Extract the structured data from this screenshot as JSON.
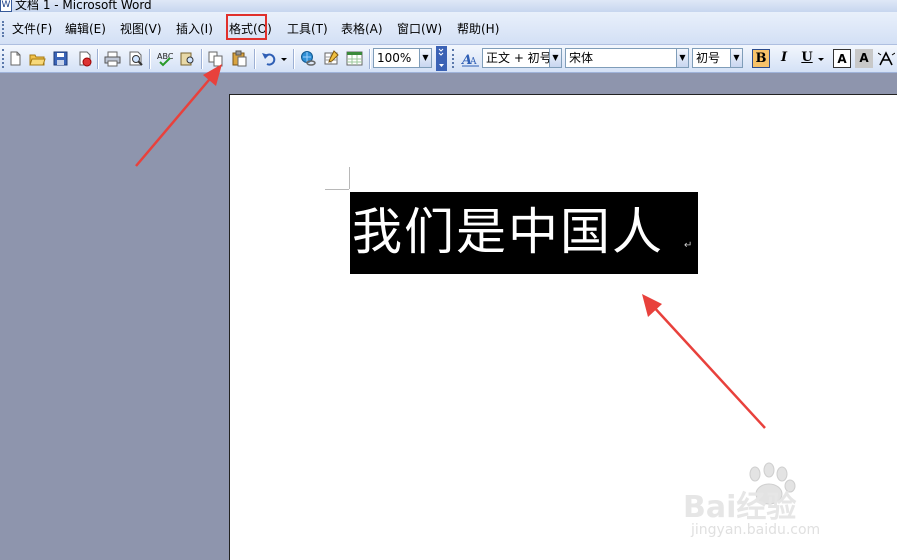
{
  "window": {
    "title": "文档 1 - Microsoft Word",
    "app_icon": "word-doc-icon"
  },
  "menubar": {
    "items": [
      {
        "label": "文件(F)"
      },
      {
        "label": "编辑(E)"
      },
      {
        "label": "视图(V)"
      },
      {
        "label": "插入(I)"
      },
      {
        "label": "格式(O)"
      },
      {
        "label": "工具(T)"
      },
      {
        "label": "表格(A)"
      },
      {
        "label": "窗口(W)"
      },
      {
        "label": "帮助(H)"
      }
    ],
    "highlighted_item": "格式(O)",
    "highlight_color": "#e0302c"
  },
  "toolbar": {
    "zoom": "100%",
    "style": "正文 + 初号",
    "font": "宋体",
    "font_size": "初号",
    "bold_active": true,
    "bold_label": "B",
    "italic_label": "I",
    "underline_label": "U",
    "font_color_label": "A",
    "char_shading_label": "A"
  },
  "document": {
    "text": "我们是中国人",
    "paragraph_mark": "↵",
    "selection_color": "#000000",
    "text_color": "#ffffff"
  },
  "watermark": {
    "brand": "Bai经验",
    "url": "jingyan.baidu.com"
  },
  "annotation_color": "#e8413c"
}
